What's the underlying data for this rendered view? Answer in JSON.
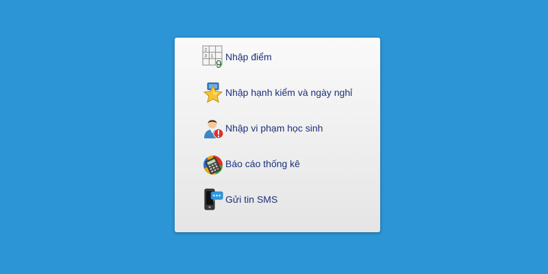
{
  "menu": {
    "items": [
      {
        "label": "Nhập điểm",
        "icon": "score-grid-icon"
      },
      {
        "label": "Nhập hạnh kiểm và ngày nghỉ",
        "icon": "star-icon"
      },
      {
        "label": "Nhập vi phạm học sinh",
        "icon": "user-warning-icon"
      },
      {
        "label": "Báo cáo thống kê",
        "icon": "calculator-chart-icon"
      },
      {
        "label": "Gửi tin SMS",
        "icon": "phone-message-icon"
      }
    ]
  },
  "grid_icon_digits": {
    "top": "2",
    "mid": "3",
    "mid2": "1",
    "big": "9"
  },
  "colors": {
    "background": "#2b95d6",
    "card_top": "#fafafa",
    "card_bottom": "#e5e5e5",
    "label": "#1c2f7a"
  }
}
